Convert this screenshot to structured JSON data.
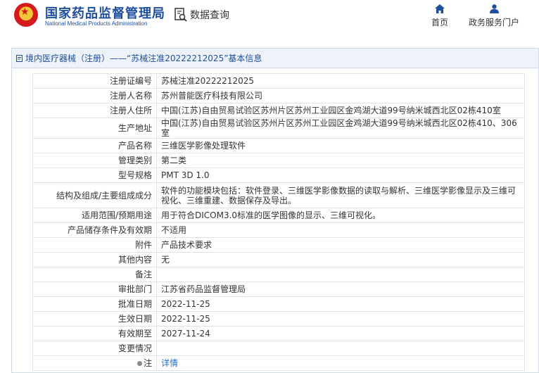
{
  "header": {
    "brand_cn": "国家药品监督管理局",
    "brand_en": "National Medical Products Administration",
    "section_title": "数据查询",
    "nav": [
      {
        "label": "首页",
        "icon": "home-icon"
      },
      {
        "label": "政务服务门户",
        "icon": "user-icon"
      }
    ],
    "accent_color": "#1f4e9c"
  },
  "breadcrumb": "境内医疗器械（注册）——“苏械注准20222212025”基本信息",
  "details": [
    {
      "label": "注册证编号",
      "value": "苏械注准20222212025"
    },
    {
      "label": "注册人名称",
      "value": "苏州普能医疗科技有限公司"
    },
    {
      "label": "注册人住所",
      "value": "中国(江苏)自由贸易试验区苏州片区苏州工业园区金鸡湖大道99号纳米城西北区02栋410室"
    },
    {
      "label": "生产地址",
      "value": "中国(江苏)自由贸易试验区苏州片区苏州工业园区金鸡湖大道99号纳米城西北区02栋410、306室"
    },
    {
      "label": "产品名称",
      "value": "三维医学影像处理软件"
    },
    {
      "label": "管理类别",
      "value": "第二类"
    },
    {
      "label": "型号规格",
      "value": "PMT 3D 1.0"
    },
    {
      "label": "结构及组成/主要组成成分",
      "value": "软件的功能模块包括：软件登录、三维医学影像数据的读取与解析、三维医学影像显示及三维可视化、三维重建、数据保存及导出。"
    },
    {
      "label": "适用范围/预期用途",
      "value": "用于符合DICOM3.0标准的医学图像的显示、三维可视化。"
    },
    {
      "label": "产品储存条件及有效期",
      "value": "不适用"
    },
    {
      "label": "附件",
      "value": "产品技术要求"
    },
    {
      "label": "其他内容",
      "value": "无"
    },
    {
      "label": "备注",
      "value": ""
    },
    {
      "label": "审批部门",
      "value": "江苏省药品监督管理局"
    },
    {
      "label": "批准日期",
      "value": "2022-11-25"
    },
    {
      "label": "生效日期",
      "value": "2022-11-25"
    },
    {
      "label": "有效期至",
      "value": "2027-11-24"
    },
    {
      "label": "变更情况",
      "value": ""
    }
  ],
  "note": {
    "label": "注",
    "link": "详情"
  }
}
